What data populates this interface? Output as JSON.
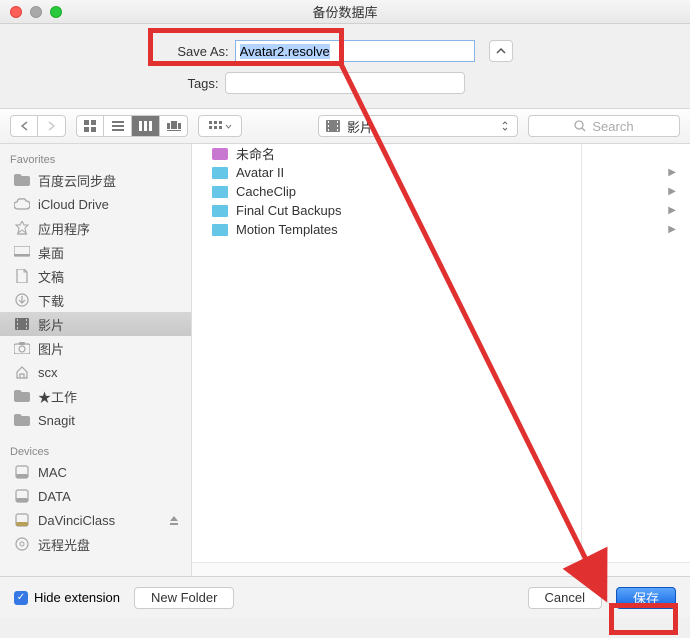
{
  "window": {
    "title": "备份数据库"
  },
  "save": {
    "label": "Save As:",
    "filename": "Avatar2.resolve"
  },
  "tags": {
    "label": "Tags:",
    "value": ""
  },
  "toolbar": {
    "path": "影片",
    "search_placeholder": "Search"
  },
  "sidebar": {
    "favorites_label": "Favorites",
    "devices_label": "Devices",
    "favorites": [
      {
        "label": "百度云同步盘",
        "icon": "folder"
      },
      {
        "label": "iCloud Drive",
        "icon": "cloud"
      },
      {
        "label": "应用程序",
        "icon": "apps"
      },
      {
        "label": "桌面",
        "icon": "desktop"
      },
      {
        "label": "文稿",
        "icon": "docs"
      },
      {
        "label": "下载",
        "icon": "download"
      },
      {
        "label": "影片",
        "icon": "movies",
        "selected": true
      },
      {
        "label": "图片",
        "icon": "pictures"
      },
      {
        "label": "scx",
        "icon": "home"
      },
      {
        "label": "★工作",
        "icon": "folder"
      },
      {
        "label": "Snagit",
        "icon": "folder"
      }
    ],
    "devices": [
      {
        "label": "MAC",
        "icon": "disk"
      },
      {
        "label": "DATA",
        "icon": "disk"
      },
      {
        "label": "DaVinciClass",
        "icon": "disk-ext",
        "eject": true
      },
      {
        "label": "远程光盘",
        "icon": "optical"
      }
    ]
  },
  "files": [
    {
      "label": "未命名",
      "type": "video"
    },
    {
      "label": "Avatar II",
      "type": "folder"
    },
    {
      "label": "CacheClip",
      "type": "folder"
    },
    {
      "label": "Final Cut Backups",
      "type": "folder"
    },
    {
      "label": "Motion Templates",
      "type": "folder"
    }
  ],
  "footer": {
    "hide_ext": "Hide extension",
    "new_folder": "New Folder",
    "cancel": "Cancel",
    "save": "保存"
  }
}
